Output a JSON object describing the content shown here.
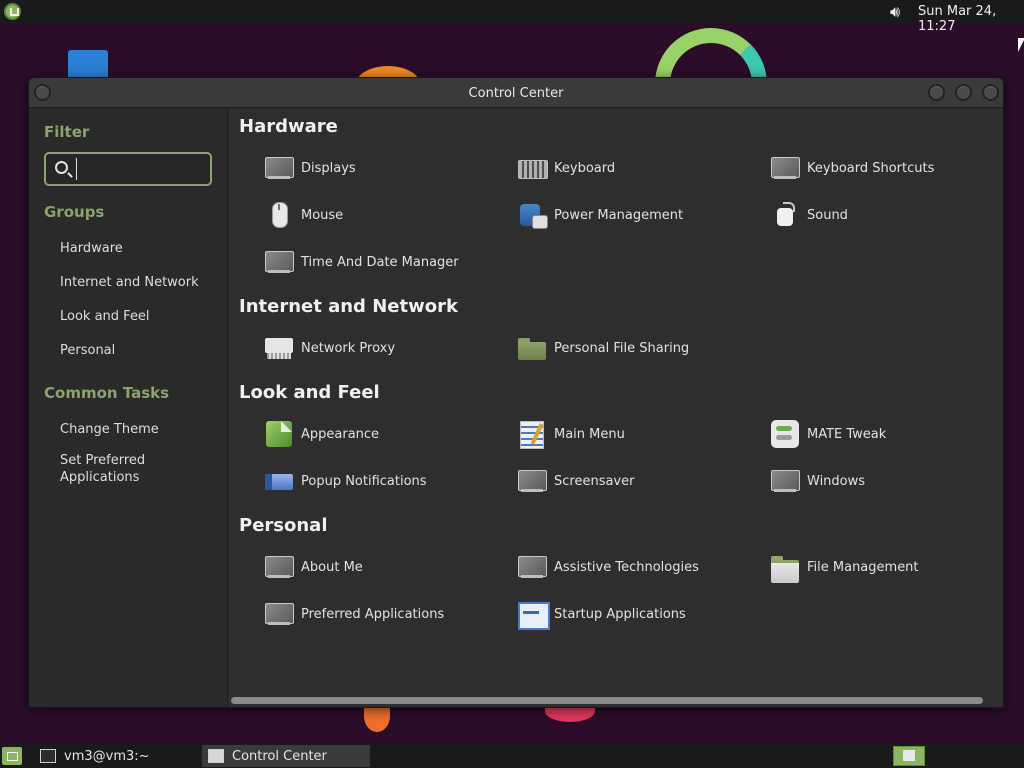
{
  "top_panel": {
    "clock": "Sun Mar 24, 11:27",
    "volume_icon": "speaker-icon"
  },
  "window": {
    "title": "Control Center"
  },
  "sidebar": {
    "filter_heading": "Filter",
    "search_value": "",
    "groups_heading": "Groups",
    "groups": [
      "Hardware",
      "Internet and Network",
      "Look and Feel",
      "Personal"
    ],
    "tasks_heading": "Common Tasks",
    "tasks": [
      "Change Theme",
      "Set Preferred Applications"
    ]
  },
  "sections": {
    "hardware": {
      "title": "Hardware",
      "items": [
        "Displays",
        "Keyboard",
        "Keyboard Shortcuts",
        "Mouse",
        "Power Management",
        "Sound",
        "Time And Date Manager"
      ]
    },
    "internet": {
      "title": "Internet and Network",
      "items": [
        "Network Proxy",
        "Personal File Sharing"
      ]
    },
    "look": {
      "title": "Look and Feel",
      "items": [
        "Appearance",
        "Main Menu",
        "MATE Tweak",
        "Popup Notifications",
        "Screensaver",
        "Windows"
      ]
    },
    "personal": {
      "title": "Personal",
      "items": [
        "About Me",
        "Assistive Technologies",
        "File Management",
        "Preferred Applications",
        "Startup Applications"
      ]
    }
  },
  "bottom_panel": {
    "tasks": [
      "vm3@vm3:~",
      "Control Center"
    ]
  },
  "colors": {
    "accent": "#8ba46e",
    "panel": "#1a1a1a",
    "window_bg": "#2e2e2e"
  }
}
